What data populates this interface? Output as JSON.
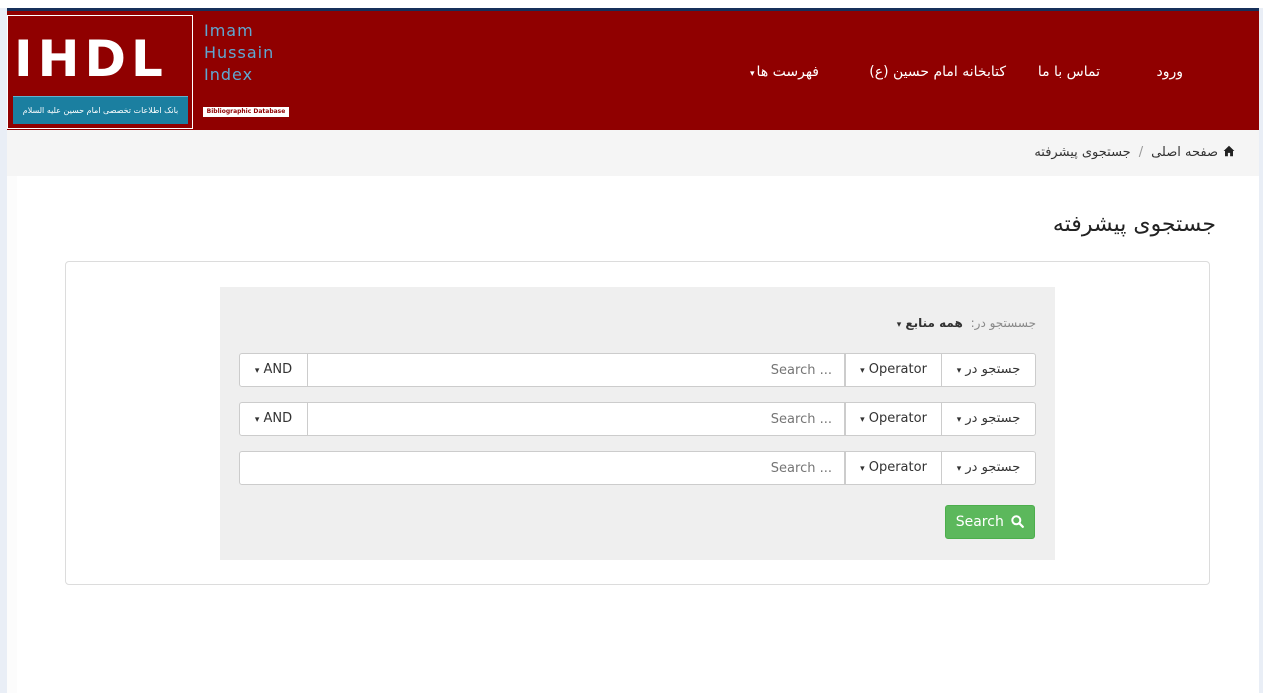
{
  "header": {
    "logo": {
      "letters": "IHDL",
      "strip_text": "بانک اطلاعات تخصصی امام حسین علیه السلام",
      "words": [
        "Imam",
        "Hussain",
        "Index"
      ],
      "badge": "Bibliographic Database"
    },
    "nav": {
      "login": "ورود",
      "contact": "تماس با ما",
      "library": "کتابخانه امام حسین (ع)",
      "lists": "فهرست ها"
    }
  },
  "breadcrumb": {
    "home": "صفحه اصلی",
    "separator": "/",
    "current": "جستجوی پیشرفته"
  },
  "page": {
    "title": "جستجوی پیشرفته"
  },
  "search": {
    "scope_label": "جسستجو در:",
    "scope_value": "همه منابع",
    "rows": [
      {
        "field": "جستجو در",
        "operator": "Operator",
        "placeholder": "Search ...",
        "conjunction": "AND"
      },
      {
        "field": "جستجو در",
        "operator": "Operator",
        "placeholder": "Search ...",
        "conjunction": "AND"
      },
      {
        "field": "جستجو در",
        "operator": "Operator",
        "placeholder": "Search ..."
      }
    ],
    "submit_label": "Search"
  },
  "colors": {
    "header_bg": "#900000",
    "accent_blue": "#1b7fa0",
    "success": "#5cb85c"
  },
  "icons": {
    "home": "home-icon",
    "search": "search-icon",
    "caret": "caret-down-icon"
  }
}
